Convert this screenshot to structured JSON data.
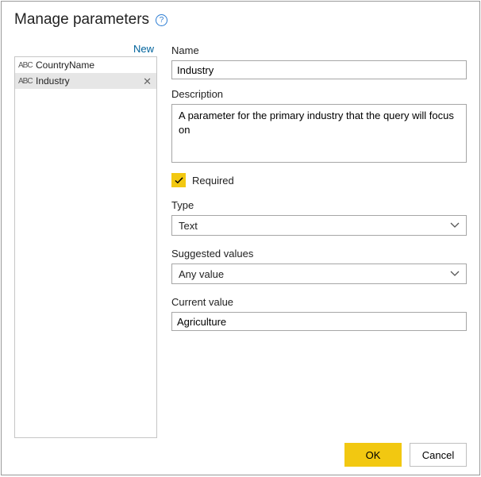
{
  "header": {
    "title": "Manage parameters",
    "help_icon": "?"
  },
  "left": {
    "new_label": "New",
    "items": [
      {
        "icon": "ABC",
        "label": "CountryName",
        "selected": false,
        "deletable": false
      },
      {
        "icon": "ABC",
        "label": "Industry",
        "selected": true,
        "deletable": true
      }
    ],
    "delete_glyph": "✕"
  },
  "form": {
    "name_label": "Name",
    "name_value": "Industry",
    "desc_label": "Description",
    "desc_value": "A parameter for the primary industry that the query will focus on",
    "required_label": "Required",
    "required_checked": true,
    "type_label": "Type",
    "type_value": "Text",
    "suggested_label": "Suggested values",
    "suggested_value": "Any value",
    "current_label": "Current value",
    "current_value": "Agriculture"
  },
  "footer": {
    "ok": "OK",
    "cancel": "Cancel"
  }
}
